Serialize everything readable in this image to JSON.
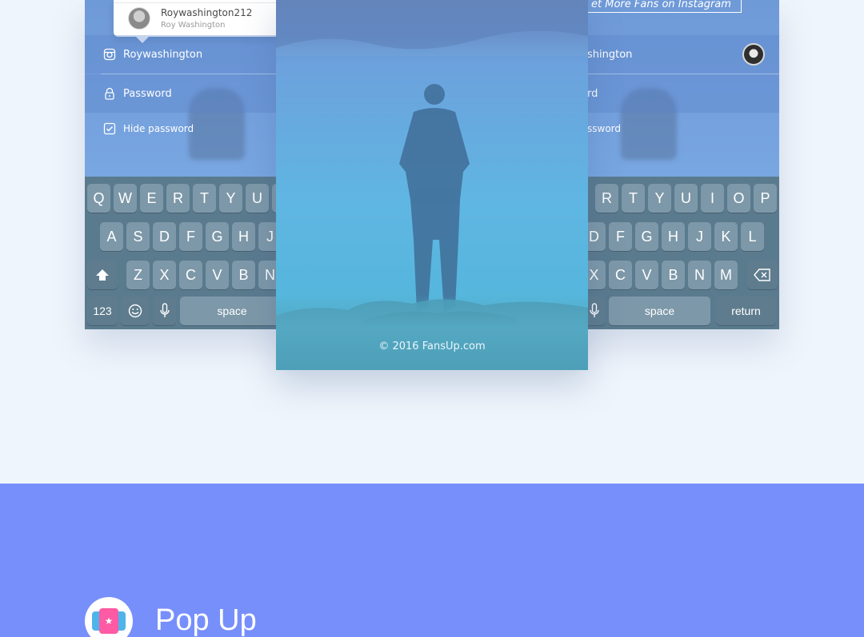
{
  "left_screen": {
    "autocomplete": {
      "username": "Roywashington212",
      "full_name": "Roy Washington"
    },
    "username_field": {
      "value": "Roywashington",
      "icon": "instagram-icon"
    },
    "password_field": {
      "placeholder": "Password",
      "icon": "lock-icon"
    },
    "hide_password": {
      "label": "Hide password",
      "checked": true
    }
  },
  "right_screen": {
    "banner_button": "et More Fans on Instagram",
    "username_field": {
      "value": "shington"
    },
    "password_field": {
      "placeholder": "rd"
    },
    "hide_password": {
      "label": "ssword"
    }
  },
  "keyboard_left": {
    "row1": [
      "Q",
      "W",
      "E",
      "R",
      "T",
      "Y",
      "U"
    ],
    "row2": [
      "A",
      "S",
      "D",
      "F",
      "G",
      "H",
      "J"
    ],
    "row3": [
      "Z",
      "X",
      "C",
      "V",
      "B",
      "N"
    ],
    "bottom": {
      "numbers": "123",
      "space": "space"
    }
  },
  "keyboard_right": {
    "row1": [
      "R",
      "T",
      "Y",
      "U",
      "I",
      "O",
      "P"
    ],
    "row2": [
      "D",
      "F",
      "G",
      "H",
      "J",
      "K",
      "L"
    ],
    "row3": [
      "X",
      "C",
      "V",
      "B",
      "N",
      "M"
    ],
    "bottom": {
      "space": "space",
      "return": "return"
    }
  },
  "center_card": {
    "copyright": "© 2016 FansUp.com"
  },
  "section": {
    "title": "Pop Up",
    "icon": "popup-cards-icon"
  },
  "colors": {
    "page_bg": "#eff5fc",
    "section_bg": "#778ffb",
    "keyboard_bg": "#5a7a8e",
    "accent_pink": "#ff5aa4",
    "accent_blue": "#4fb4ea"
  }
}
